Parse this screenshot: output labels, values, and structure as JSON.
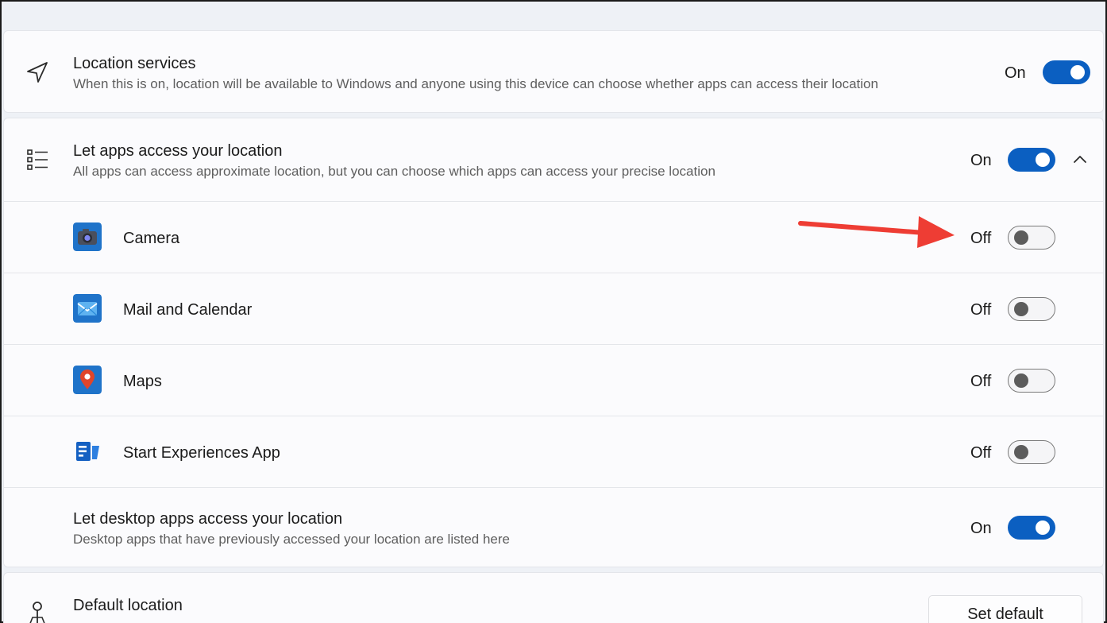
{
  "location_services": {
    "title": "Location services",
    "description": "When this is on, location will be available to Windows and anyone using this device can choose whether apps can access their location",
    "state_label": "On",
    "enabled": true
  },
  "app_access": {
    "title": "Let apps access your location",
    "description": "All apps can access approximate location, but you can choose which apps can access your precise location",
    "state_label": "On",
    "enabled": true,
    "apps": [
      {
        "label": "Camera",
        "state_label": "Off",
        "enabled": false
      },
      {
        "label": "Mail and Calendar",
        "state_label": "Off",
        "enabled": false
      },
      {
        "label": "Maps",
        "state_label": "Off",
        "enabled": false
      },
      {
        "label": "Start Experiences App",
        "state_label": "Off",
        "enabled": false
      }
    ],
    "desktop": {
      "title": "Let desktop apps access your location",
      "description": "Desktop apps that have previously accessed your location are listed here",
      "state_label": "On",
      "enabled": true
    }
  },
  "default_location": {
    "title": "Default location",
    "button_label": "Set default"
  },
  "colors": {
    "accent": "#0b5fc1",
    "annotation_arrow": "#ee3d34"
  },
  "icons": {
    "location_services": "navigation-arrow-icon",
    "app_access": "list-icon",
    "default_location": "location-pin-icon"
  }
}
